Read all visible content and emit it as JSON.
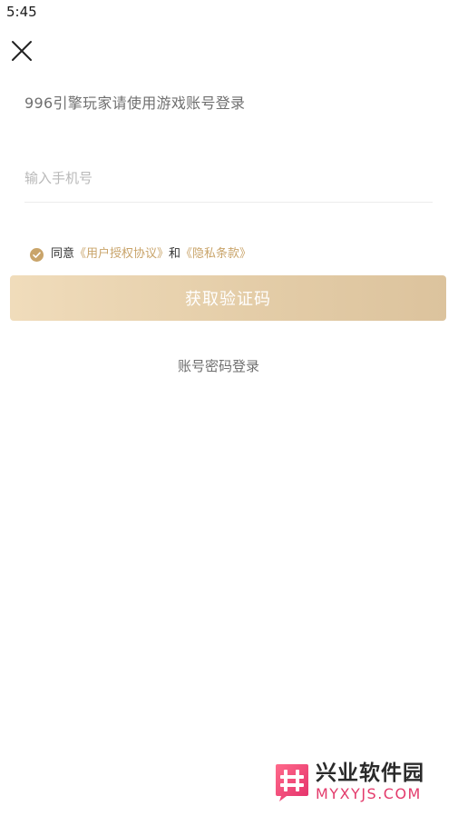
{
  "status_bar": {
    "time": "5:45"
  },
  "header": {
    "close_icon": "close-icon"
  },
  "login": {
    "subtitle": "996引擎玩家请使用游戏账号登录",
    "phone_input": {
      "placeholder": "输入手机号",
      "value": ""
    },
    "agreement": {
      "checked": true,
      "prefix": "同意",
      "user_agreement_link": "《用户授权协议》",
      "conjunction": "和",
      "privacy_link": "《隐私条款》"
    },
    "get_code_button": "获取验证码",
    "password_login_link": "账号密码登录"
  },
  "watermark": {
    "name_cn": "兴业软件园",
    "domain": "MYXYJS.COM"
  },
  "colors": {
    "accent": "#c9a46a",
    "button_gradient_start": "#f0dcbb",
    "button_gradient_end": "#dcc39d",
    "watermark": "#e33a6b"
  }
}
